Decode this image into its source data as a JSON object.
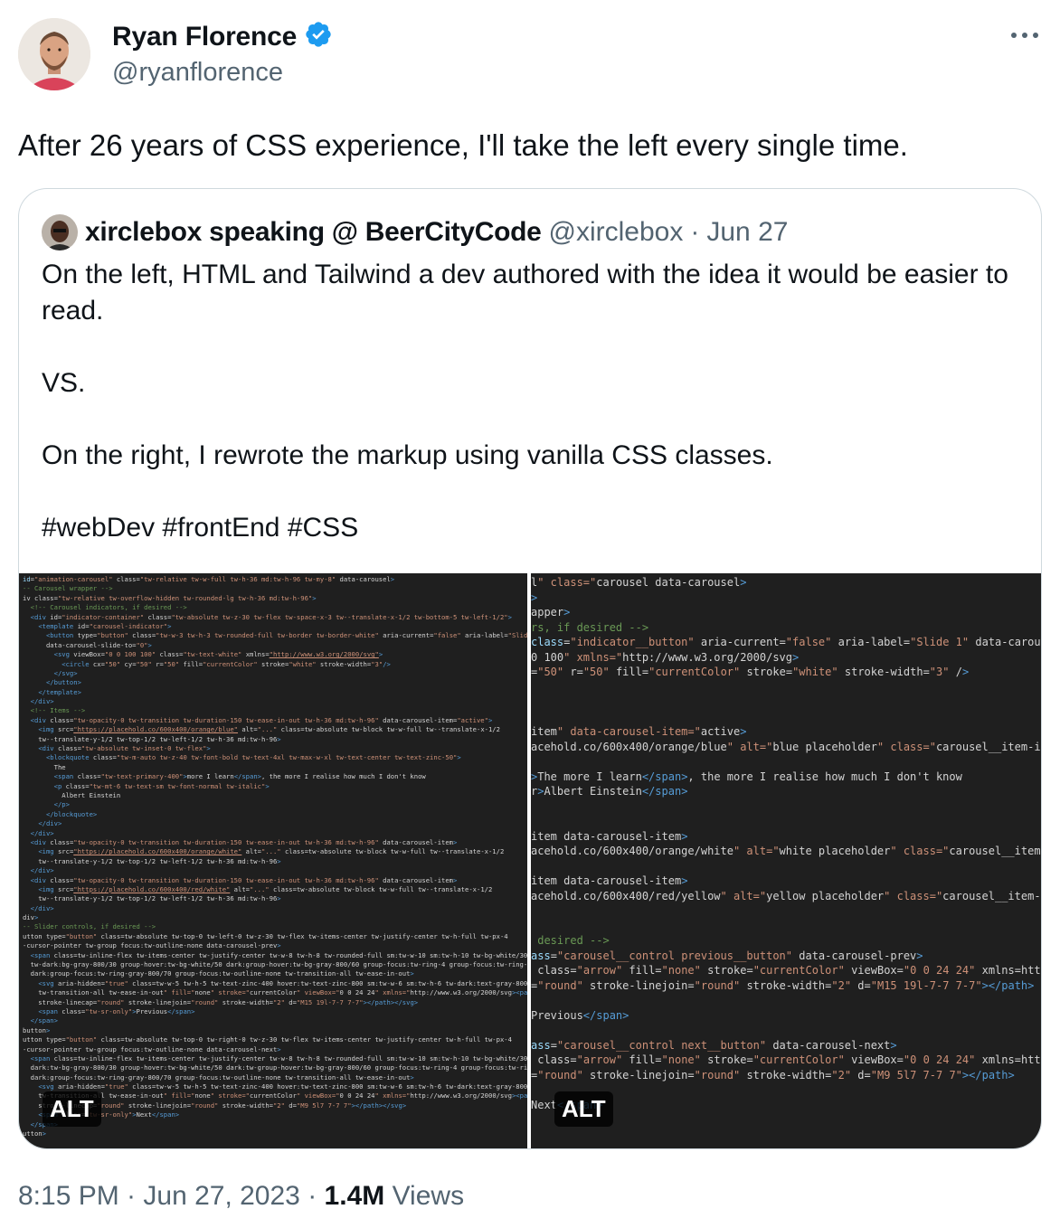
{
  "tweet": {
    "author": {
      "name": "Ryan Florence",
      "handle": "@ryanflorence",
      "verified": true,
      "verified_color": "#1d9bf0"
    },
    "text": "After 26 years of CSS experience, I'll take the left every single time.",
    "timestamp": "8:15 PM · Jun 27, 2023",
    "views_count": "1.4M",
    "views_label": "Views",
    "more_icon": "ellipsis-icon"
  },
  "quote": {
    "author_name": "xirclebox speaking @ BeerCityCode",
    "handle": "@xirclebox",
    "separator": "·",
    "date": "Jun 27",
    "paragraphs": [
      "On the left, HTML and Tailwind a dev authored with the idea it would be easier to read.",
      "",
      "VS.",
      "",
      "On the right, I rewrote the markup using vanilla CSS classes.",
      "",
      "#webDev #frontEnd #CSS"
    ],
    "media": [
      {
        "alt_badge": "ALT",
        "code_lines": [
          "id=\"animation-carousel\" class=\"tw-relative tw-w-full tw-h-36 md:tw-h-96 tw-my-8\" data-carousel>",
          "-- Carousel wrapper -->",
          "iv class=\"tw-relative tw-overflow-hidden tw-rounded-lg tw-h-36 md:tw-h-96\">",
          "  <!-- Carousel indicators, if desired -->",
          "  <div id=\"indicator-container\" class=\"tw-absolute tw-z-30 tw-flex tw-space-x-3 tw--translate-x-1/2 tw-bottom-5 tw-left-1/2\">",
          "    <template id=\"carousel-indicator\">",
          "      <button type=\"button\" class=\"tw-w-3 tw-h-3 tw-rounded-full tw-border tw-border-white\" aria-current=\"false\" aria-label=\"Slide 1\"",
          "      data-carousel-slide-to=\"0\">",
          "        <svg viewBox=\"0 0 100 100\" class=\"tw-text-white\" xmlns=\"http://www.w3.org/2000/svg\">",
          "          <circle cx=\"50\" cy=\"50\" r=\"50\" fill=\"currentColor\" stroke=\"white\" stroke-width=\"3\"/>",
          "        </svg>",
          "      </button>",
          "    </template>",
          "  </div>",
          "  <!-- Items -->",
          "  <div class=\"tw-opacity-0 tw-transition tw-duration-150 tw-ease-in-out tw-h-36 md:tw-h-96\" data-carousel-item=\"active\">",
          "    <img src=\"https://placehold.co/600x400/orange/blue\" alt=\"...\" class=\"tw-absolute tw-block tw-w-full tw--translate-x-1/2",
          "    tw--translate-y-1/2 tw-top-1/2 tw-left-1/2 tw-h-36 md:tw-h-96\">",
          "    <div class=\"tw-absolute tw-inset-0 tw-flex\">",
          "      <blockquote class=\"tw-m-auto tw-z-40 tw-font-bold tw-text-4xl tw-max-w-xl tw-text-center tw-text-zinc-50\">",
          "        The",
          "        <span class=\"tw-text-primary-400\">more I learn</span>, the more I realise how much I don't know",
          "        <p class=\"tw-mt-6 tw-text-sm tw-font-normal tw-italic\">",
          "          Albert Einstein",
          "        </p>",
          "      </blockquote>",
          "    </div>",
          "  </div>",
          "  <div class=\"tw-opacity-0 tw-transition tw-duration-150 tw-ease-in-out tw-h-36 md:tw-h-96\" data-carousel-item>",
          "    <img src=\"https://placehold.co/600x400/orange/white\" alt=\"...\" class=\"tw-absolute tw-block tw-w-full tw--translate-x-1/2",
          "    tw--translate-y-1/2 tw-top-1/2 tw-left-1/2 tw-h-36 md:tw-h-96\">",
          "  </div>",
          "  <div class=\"tw-opacity-0 tw-transition tw-duration-150 tw-ease-in-out tw-h-36 md:tw-h-96\" data-carousel-item>",
          "    <img src=\"https://placehold.co/600x400/red/white\" alt=\"...\" class=\"tw-absolute tw-block tw-w-full tw--translate-x-1/2",
          "    tw--translate-y-1/2 tw-top-1/2 tw-left-1/2 tw-h-36 md:tw-h-96\">",
          "  </div>",
          "div>",
          "-- Slider controls, if desired -->",
          "utton type=\"button\" class=\"tw-absolute tw-top-0 tw-left-0 tw-z-30 tw-flex tw-items-center tw-justify-center tw-h-full tw-px-4",
          "-cursor-pointer tw-group focus:tw-outline-none\" data-carousel-prev>",
          "  <span class=\"tw-inline-flex tw-items-center tw-justify-center tw-w-8 tw-h-8 tw-rounded-full sm:tw-w-10 sm:tw-h-10 tw-bg-white/30",
          "  tw-dark:bg-gray-800/30 group-hover:tw-bg-white/50 dark:group-hover:tw-bg-gray-800/60 group-focus:tw-ring-4 group-focus:tw-ring-white",
          "  dark:group-focus:tw-ring-gray-800/70 group-focus:tw-outline-none tw-transition-all tw-ease-in-out\">",
          "    <svg aria-hidden=\"true\" class=\"tw-w-5 tw-h-5 tw-text-zinc-400 hover:tw-text-zinc-800 sm:tw-w-6 sm:tw-h-6 tw-dark:text-gray-800",
          "    tw-transition-all tw-ease-in-out\" fill=\"none\" stroke=\"currentColor\" viewBox=\"0 0 24 24\" xmlns=\"http://www.w3.org/2000/svg\"><path",
          "    stroke-linecap=\"round\" stroke-linejoin=\"round\" stroke-width=\"2\" d=\"M15 19l-7-7 7-7\"></path></svg>",
          "    <span class=\"tw-sr-only\">Previous</span>",
          "  </span>",
          "button>",
          "utton type=\"button\" class=\"tw-absolute tw-top-0 tw-right-0 tw-z-30 tw-flex tw-items-center tw-justify-center tw-h-full tw-px-4",
          "-cursor-pointer tw-group focus:tw-outline-none\" data-carousel-next>",
          "  <span class=\"tw-inline-flex tw-items-center tw-justify-center tw-w-8 tw-h-8 tw-rounded-full sm:tw-w-10 sm:tw-h-10 tw-bg-white/30",
          "  dark:tw-bg-gray-800/30 group-hover:tw-bg-white/50 dark:tw-group-hover:tw-bg-gray-800/60 group-focus:tw-ring-4 group-focus:tw-ring-white",
          "  dark:group-focus:tw-ring-gray-800/70 group-focus:tw-outline-none tw-transition-all tw-ease-in-out\">",
          "    <svg aria-hidden=\"true\" class=\"tw-w-5 tw-h-5 tw-text-zinc-400 hover:tw-text-zinc-800 sm:tw-w-6 sm:tw-h-6 tw-dark:text-gray-800",
          "    tw-transition-all tw-ease-in-out\" fill=\"none\" stroke=\"currentColor\" viewBox=\"0 0 24 24\" xmlns=\"http://www.w3.org/2000/svg\"><path",
          "    stroke-linecap=\"round\" stroke-linejoin=\"round\" stroke-width=\"2\" d=\"M9 5l7 7-7 7\"></path></svg>",
          "    <span class=\"tw-sr-only\">Next</span>",
          "  </span>",
          "utton>"
        ]
      },
      {
        "alt_badge": "ALT",
        "code_lines": [
          "l\" class=\"carousel\" data-carousel>",
          ">",
          "apper\">",
          "rs, if desired -->",
          "class=\"indicator__button\" aria-current=\"false\" aria-label=\"Slide 1\" data-carousel-sli",
          "0 100\" xmlns=\"http://www.w3.org/2000/svg\">",
          "=\"50\" r=\"50\" fill=\"currentColor\" stroke=\"white\" stroke-width=\"3\" />",
          "",
          "",
          "",
          "item\" data-carousel-item=\"active\">",
          "acehold.co/600x400/orange/blue\" alt=\"blue placeholder\" class=\"carousel__item-image\">",
          "",
          "\">The more I learn</span>, the more I realise how much I don't know",
          "r\">Albert Einstein</span>",
          "",
          "",
          "item\" data-carousel-item>",
          "acehold.co/600x400/orange/white\" alt=\"white placeholder\" class=\"carousel__item-image\"",
          "",
          "item\" data-carousel-item>",
          "acehold.co/600x400/red/yellow\" alt=\"yellow placeholder\" class=\"carousel__item-image\">",
          "",
          "",
          " desired -->",
          "ass=\"carousel__control previous__button\" data-carousel-prev>",
          " class=\"arrow\" fill=\"none\" stroke=\"currentColor\" viewBox=\"0 0 24 24\" xmlns=\"http://w",
          "=\"round\" stroke-linejoin=\"round\" stroke-width=\"2\" d=\"M15 19l-7-7 7-7\"></path>",
          "",
          "Previous</span>",
          "",
          "ass=\"carousel__control next__button\" data-carousel-next>",
          " class=\"arrow\" fill=\"none\" stroke=\"currentColor\" viewBox=\"0 0 24 24\" xmlns=\"http://w",
          "=\"round\" stroke-linejoin=\"round\" stroke-width=\"2\" d=\"M9 5l7 7-7 7\"></path>",
          "",
          "Next</span>"
        ]
      }
    ]
  }
}
